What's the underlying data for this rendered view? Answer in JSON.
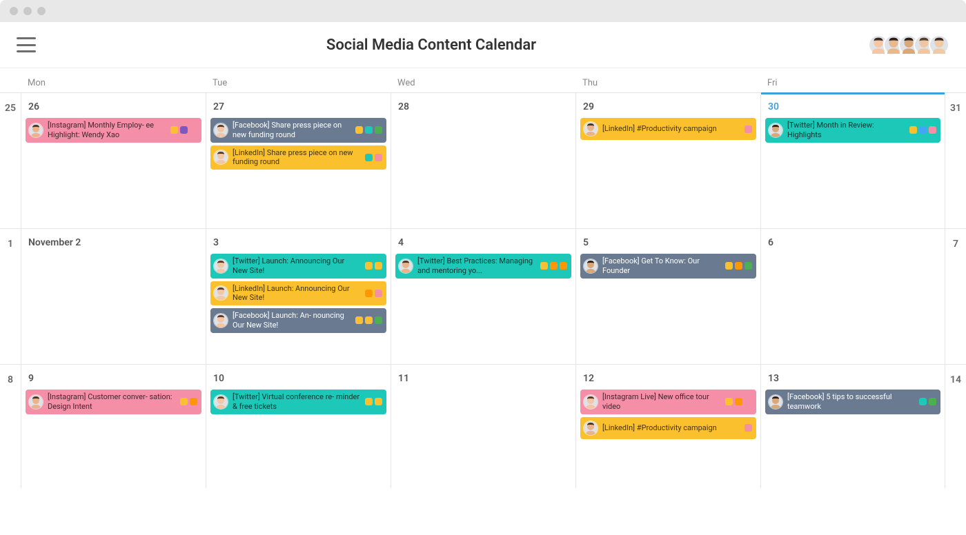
{
  "header": {
    "title": "Social Media Content Calendar",
    "avatars": [
      "f1",
      "m2",
      "m3",
      "m4",
      "m5"
    ]
  },
  "days": [
    "Mon",
    "Tue",
    "Wed",
    "Thu",
    "Fri"
  ],
  "weeks": [
    {
      "left": "25",
      "right": "31",
      "cells": [
        {
          "date": "26",
          "highlight": false,
          "tasks": [
            {
              "color": "pink",
              "avatar": "m1",
              "text": "[Instagram] Monthly Employ-\nee Highlight: Wendy Xao",
              "tags": [
                "yellow",
                "purple",
                "pink"
              ]
            }
          ]
        },
        {
          "date": "27",
          "highlight": false,
          "tasks": [
            {
              "color": "slate",
              "avatar": "f2",
              "text": "[Facebook] Share press piece on new funding round",
              "tags": [
                "yellow",
                "teal",
                "green"
              ]
            },
            {
              "color": "yellow",
              "avatar": "f2",
              "text": "[LinkedIn] Share press piece on new funding round",
              "tags": [
                "teal",
                "pink"
              ]
            }
          ]
        },
        {
          "date": "28",
          "highlight": false,
          "tasks": []
        },
        {
          "date": "29",
          "highlight": false,
          "tasks": [
            {
              "color": "yellow",
              "avatar": "m1",
              "text": "[LinkedIn] #Productivity campaign",
              "tags": [
                "pink"
              ]
            }
          ]
        },
        {
          "date": "30",
          "highlight": true,
          "tasks": [
            {
              "color": "teal",
              "avatar": "m3",
              "text": "[Twitter] Month in Review: Highlights",
              "tags": [
                "yellow",
                "blue",
                "pink"
              ]
            }
          ]
        }
      ]
    },
    {
      "left": "1",
      "right": "7",
      "cells": [
        {
          "date": "November 2",
          "highlight": false,
          "tasks": []
        },
        {
          "date": "3",
          "highlight": false,
          "tasks": [
            {
              "color": "teal",
              "avatar": "f2",
              "text": "[Twitter] Launch: Announcing Our New Site!",
              "tags": [
                "yellow",
                "yellow"
              ]
            },
            {
              "color": "yellow",
              "avatar": "f2",
              "text": "[LinkedIn] Launch: Announcing Our New Site!",
              "tags": [
                "orange",
                "pink"
              ]
            },
            {
              "color": "slate",
              "avatar": "f2",
              "text": "[Facebook] Launch: An-\nnouncing Our New Site!",
              "tags": [
                "yellow",
                "yellow",
                "green"
              ]
            }
          ]
        },
        {
          "date": "4",
          "highlight": false,
          "tasks": [
            {
              "color": "teal",
              "avatar": "m1",
              "text": "[Twitter] Best Practices: Managing and mentoring yo...",
              "tags": [
                "yellow",
                "orange",
                "orange"
              ]
            }
          ]
        },
        {
          "date": "5",
          "highlight": false,
          "tasks": [
            {
              "color": "slate",
              "avatar": "m3",
              "text": "[Facebook] Get To Know: Our Founder",
              "tags": [
                "yellow",
                "orange",
                "green"
              ]
            }
          ]
        },
        {
          "date": "6",
          "highlight": false,
          "tasks": []
        }
      ]
    },
    {
      "left": "8",
      "right": "14",
      "cells": [
        {
          "date": "9",
          "highlight": false,
          "tasks": [
            {
              "color": "pink",
              "avatar": "m1",
              "text": "[Instagram] Customer conver-\nsation: Design Intent",
              "tags": [
                "yellow",
                "orange"
              ]
            }
          ]
        },
        {
          "date": "10",
          "highlight": false,
          "tasks": [
            {
              "color": "teal",
              "avatar": "f2",
              "text": "[Twitter] Virtual conference re-\nminder & free tickets",
              "tags": [
                "yellow",
                "yellow"
              ]
            }
          ]
        },
        {
          "date": "11",
          "highlight": false,
          "tasks": []
        },
        {
          "date": "12",
          "highlight": false,
          "tasks": [
            {
              "color": "pink",
              "avatar": "f2",
              "text": "[Instagram Live] New office tour video",
              "tags": [
                "yellow",
                "orange",
                "pink"
              ]
            },
            {
              "color": "yellow",
              "avatar": "m1",
              "text": "[LinkedIn] #Productivity campaign",
              "tags": [
                "pink"
              ]
            }
          ]
        },
        {
          "date": "13",
          "highlight": false,
          "tasks": [
            {
              "color": "slate",
              "avatar": "m3",
              "text": "[Facebook] 5 tips to successful teamwork",
              "tags": [
                "teal",
                "green"
              ]
            }
          ]
        }
      ]
    }
  ]
}
